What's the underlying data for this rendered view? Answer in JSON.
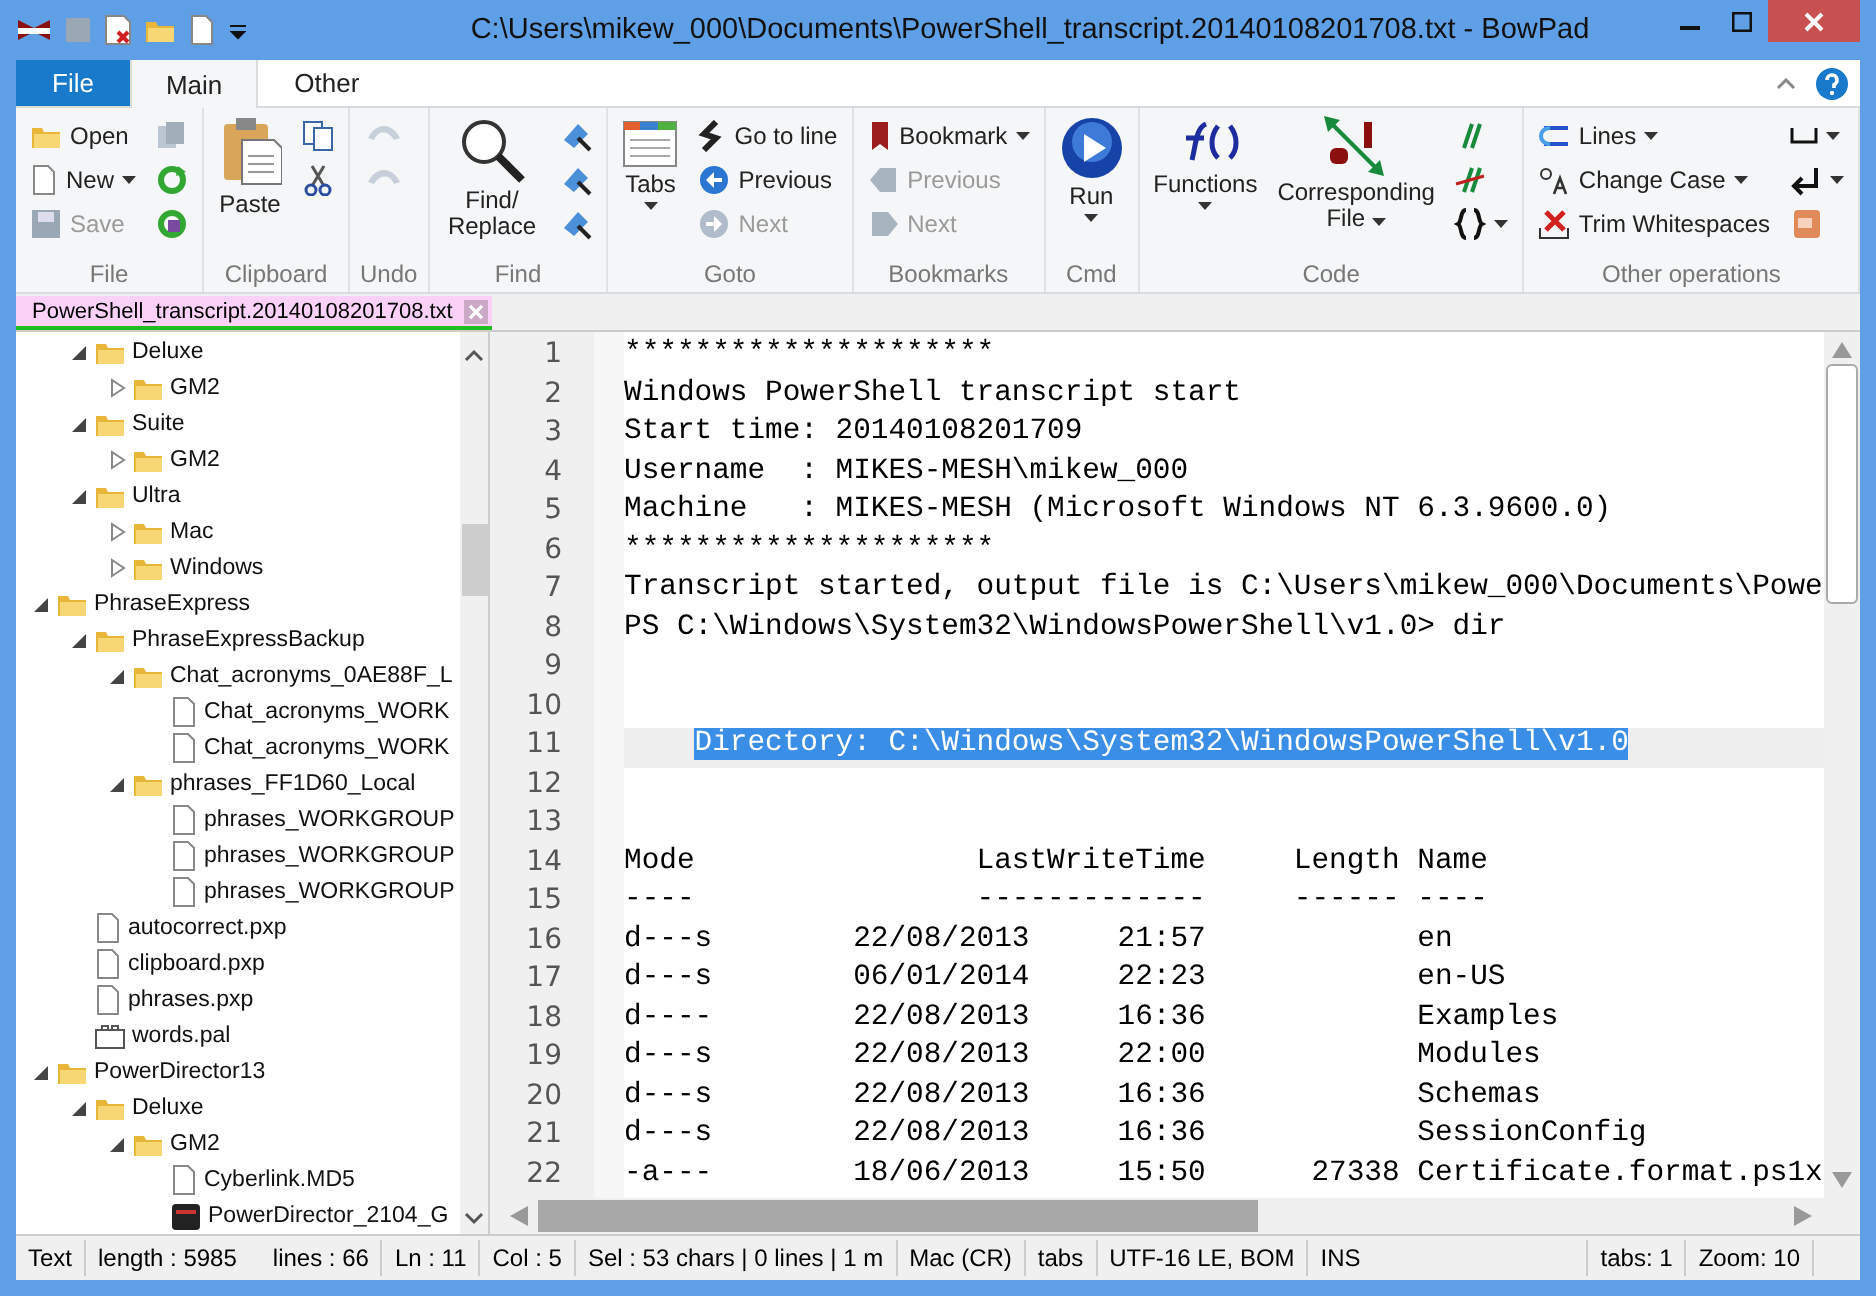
{
  "window": {
    "title": "C:\\Users\\mikew_000\\Documents\\PowerShell_transcript.20140108201708.txt - BowPad"
  },
  "ribbon": {
    "tabs": [
      {
        "label": "File",
        "kind": "app"
      },
      {
        "label": "Main",
        "kind": "tab",
        "selected": true
      },
      {
        "label": "Other",
        "kind": "tab",
        "selected": false
      }
    ],
    "groups": [
      {
        "label": "File",
        "columns": [
          [
            {
              "label": "Open",
              "disabled": false
            },
            {
              "label": "New",
              "disabled": false,
              "dropdown": true
            },
            {
              "label": "Save",
              "disabled": true
            }
          ],
          [
            {
              "disabled": false
            },
            {
              "disabled": false
            },
            {
              "disabled": false
            }
          ]
        ]
      },
      {
        "label": "Clipboard",
        "columns": [
          [
            {
              "label": "Paste",
              "kind": "large",
              "disabled": false
            }
          ],
          [
            {
              "disabled": false
            },
            {
              "disabled": false
            }
          ]
        ]
      },
      {
        "label": "Undo",
        "columns": [
          [
            {
              "disabled": true
            },
            {
              "disabled": true
            }
          ]
        ]
      },
      {
        "label": "Find",
        "columns": [
          [
            {
              "label": "Find/ Replace",
              "kind": "large",
              "disabled": false
            }
          ],
          [
            {
              "disabled": false
            },
            {
              "disabled": false
            },
            {
              "disabled": false
            }
          ]
        ]
      },
      {
        "label": "Goto",
        "columns": [
          [
            {
              "label": "Tabs",
              "kind": "large",
              "disabled": false,
              "dropdown": true
            }
          ],
          [
            {
              "label": "Go to line",
              "disabled": false
            },
            {
              "label": "Previous",
              "disabled": false
            },
            {
              "label": "Next",
              "disabled": true
            }
          ]
        ]
      },
      {
        "label": "Bookmarks",
        "columns": [
          [
            {
              "label": "Bookmark",
              "disabled": false,
              "dropdown": true
            },
            {
              "label": "Previous",
              "disabled": true
            },
            {
              "label": "Next",
              "disabled": true
            }
          ]
        ]
      },
      {
        "label": "Cmd",
        "columns": [
          [
            {
              "label": "Run",
              "kind": "large",
              "disabled": false,
              "dropdown": true
            }
          ]
        ]
      },
      {
        "label": "Code",
        "columns": [
          [
            {
              "label": "Functions",
              "kind": "large",
              "disabled": false,
              "dropdown": true
            }
          ],
          [
            {
              "label": "Corresponding File",
              "kind": "large",
              "disabled": false,
              "dropdown": true
            }
          ],
          [
            {
              "disabled": false
            },
            {
              "disabled": false
            },
            {
              "disabled": false,
              "dropdown": true
            }
          ]
        ]
      },
      {
        "label": "Other operations",
        "columns": [
          [
            {
              "label": "Lines",
              "disabled": false,
              "dropdown": true
            },
            {
              "label": "Change Case",
              "disabled": false,
              "dropdown": true
            },
            {
              "label": "Trim Whitespaces",
              "disabled": false
            }
          ],
          [
            {
              "disabled": false,
              "dropdown": true
            },
            {
              "disabled": false,
              "dropdown": true
            },
            {
              "disabled": false
            }
          ]
        ]
      }
    ]
  },
  "document_tab": {
    "label": "PowerShell_transcript.20140108201708.txt"
  },
  "tree": {
    "continued": [
      {
        "label": "Deluxe",
        "kind": "folder",
        "expanded": true,
        "children": [
          {
            "label": "GM2",
            "kind": "folder",
            "expanded": false
          }
        ]
      },
      {
        "label": "Suite",
        "kind": "folder",
        "expanded": true,
        "children": [
          {
            "label": "GM2",
            "kind": "folder",
            "expanded": false
          }
        ]
      },
      {
        "label": "Ultra",
        "kind": "folder",
        "expanded": true,
        "children": [
          {
            "label": "Mac",
            "kind": "folder",
            "expanded": false
          },
          {
            "label": "Windows",
            "kind": "folder",
            "expanded": false
          }
        ]
      }
    ],
    "items": [
      {
        "label": "PhraseExpress",
        "kind": "folder",
        "expanded": true,
        "children": [
          {
            "label": "PhraseExpressBackup",
            "kind": "folder",
            "expanded": true,
            "children": [
              {
                "label": "Chat_acronyms_0AE88F_L",
                "kind": "folder",
                "expanded": true,
                "children": [
                  {
                    "label": "Chat_acronyms_WORK",
                    "kind": "file"
                  },
                  {
                    "label": "Chat_acronyms_WORK",
                    "kind": "file"
                  }
                ]
              },
              {
                "label": "phrases_FF1D60_Local",
                "kind": "folder",
                "expanded": true,
                "children": [
                  {
                    "label": "phrases_WORKGROUP",
                    "kind": "file"
                  },
                  {
                    "label": "phrases_WORKGROUP",
                    "kind": "file"
                  },
                  {
                    "label": "phrases_WORKGROUP",
                    "kind": "file"
                  }
                ]
              }
            ]
          },
          {
            "label": "autocorrect.pxp",
            "kind": "file"
          },
          {
            "label": "clipboard.pxp",
            "kind": "file"
          },
          {
            "label": "phrases.pxp",
            "kind": "file"
          },
          {
            "label": "words.pal",
            "kind": "palette"
          }
        ]
      },
      {
        "label": "PowerDirector13",
        "kind": "folder",
        "expanded": true,
        "children": [
          {
            "label": "Deluxe",
            "kind": "folder",
            "expanded": true,
            "children": [
              {
                "label": "GM2",
                "kind": "folder",
                "expanded": true,
                "children": [
                  {
                    "label": "Cyberlink.MD5",
                    "kind": "file"
                  },
                  {
                    "label": "PowerDirector_2104_G",
                    "kind": "media"
                  }
                ]
              }
            ]
          }
        ]
      }
    ]
  },
  "editor": {
    "lines": [
      {
        "number": "1",
        "current": false,
        "text": "*********************"
      },
      {
        "number": "2",
        "current": false,
        "text": "Windows PowerShell transcript start"
      },
      {
        "number": "3",
        "current": false,
        "text": "Start time: 20140108201709"
      },
      {
        "number": "4",
        "current": false,
        "text": "Username  : MIKES-MESH\\mikew_000"
      },
      {
        "number": "5",
        "current": false,
        "text": "Machine   : MIKES-MESH (Microsoft Windows NT 6.3.9600.0)"
      },
      {
        "number": "6",
        "current": false,
        "text": "*********************"
      },
      {
        "number": "7",
        "current": false,
        "text": "Transcript started, output file is C:\\Users\\mikew_000\\Documents\\Powe"
      },
      {
        "number": "8",
        "current": false,
        "text": "PS C:\\Windows\\System32\\WindowsPowerShell\\v1.0> dir"
      },
      {
        "number": "9",
        "current": false
      },
      {
        "number": "10",
        "current": false
      },
      {
        "number": "11",
        "current": true,
        "selected_text": "Directory: C:\\Windows\\System32\\WindowsPowerShell\\v1.0"
      },
      {
        "number": "12",
        "current": false
      },
      {
        "number": "13",
        "current": false
      },
      {
        "number": "14",
        "current": false,
        "text": "Mode                LastWriteTime     Length Name"
      },
      {
        "number": "15",
        "current": false,
        "text": "----                -------------     ------ ----"
      },
      {
        "number": "16",
        "current": false,
        "text": "d---s        22/08/2013     21:57            en"
      },
      {
        "number": "17",
        "current": false,
        "text": "d---s        06/01/2014     22:23            en-US"
      },
      {
        "number": "18",
        "current": false,
        "text": "d----        22/08/2013     16:36            Examples"
      },
      {
        "number": "19",
        "current": false,
        "text": "d---s        22/08/2013     22:00            Modules"
      },
      {
        "number": "20",
        "current": false,
        "text": "d---s        22/08/2013     16:36            Schemas"
      },
      {
        "number": "21",
        "current": false,
        "text": "d---s        22/08/2013     16:36            SessionConfig"
      },
      {
        "number": "22",
        "current": false,
        "text": "-a---        18/06/2013     15:50      27338 Certificate.format.ps1x"
      }
    ]
  },
  "status_bar": [
    [
      "Text"
    ],
    [
      "length : 5985",
      "lines : 66"
    ],
    [
      "Ln : 11"
    ],
    [
      "Col : 5"
    ],
    [
      "Sel : 53 chars | 0 lines | 1 m"
    ],
    [
      "Mac (CR)"
    ],
    [
      "tabs"
    ],
    [
      "UTF-16 LE, BOM"
    ],
    [
      "INS"
    ],
    [
      "tabs: 1"
    ],
    [
      "Zoom: 10"
    ]
  ]
}
